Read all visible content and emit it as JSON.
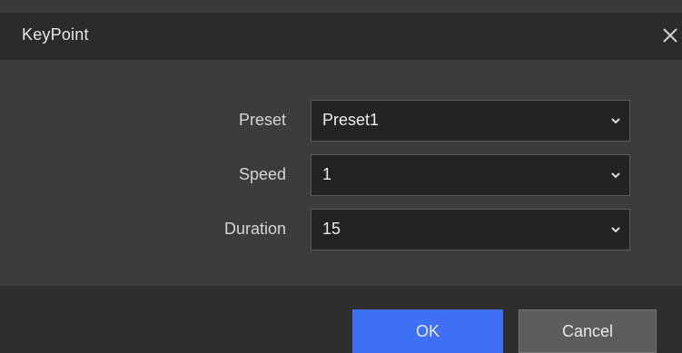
{
  "dialog": {
    "title": "KeyPoint",
    "close_icon": "close-icon"
  },
  "fields": [
    {
      "label": "Preset",
      "value": "Preset1"
    },
    {
      "label": "Speed",
      "value": "1"
    },
    {
      "label": "Duration",
      "value": "15"
    }
  ],
  "buttons": {
    "ok_label": "OK",
    "cancel_label": "Cancel"
  },
  "colors": {
    "ok_button": "#3f6ff2",
    "cancel_button": "#5c5c5c",
    "dialog_background": "#3a3a3a"
  }
}
